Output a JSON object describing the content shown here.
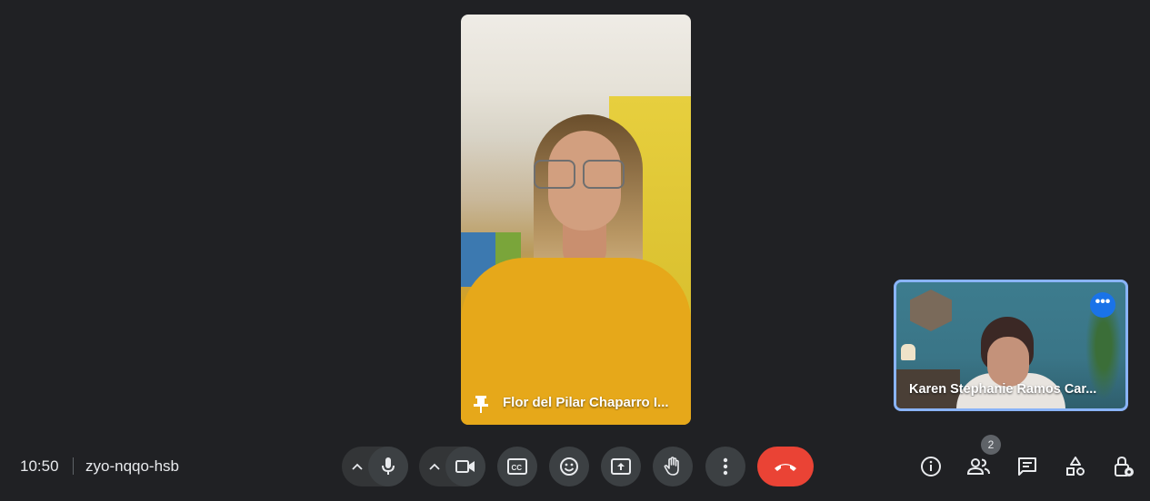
{
  "meeting": {
    "time": "10:50",
    "code": "zyo-nqqo-hsb"
  },
  "main_participant": {
    "name": "Flor del Pilar Chaparro I...",
    "icon": "pin-icon"
  },
  "self_participant": {
    "name": "Karen Stephanie Ramos Car...",
    "more_icon": "more-options-icon",
    "more_label": "•••"
  },
  "controls": {
    "items": [
      "mic-options-chevron",
      "microphone",
      "camera-options-chevron",
      "camera",
      "captions",
      "emoji-reactions",
      "present-screen",
      "raise-hand",
      "more-options",
      "leave-call"
    ]
  },
  "right_controls": {
    "items": [
      "meeting-details",
      "people",
      "chat",
      "activities",
      "host-controls"
    ],
    "people_count": "2"
  },
  "colors": {
    "background": "#202124",
    "button": "#3c4043",
    "end_call": "#ea4335",
    "accent": "#8ab4f8",
    "more_button": "#1a73e8"
  }
}
